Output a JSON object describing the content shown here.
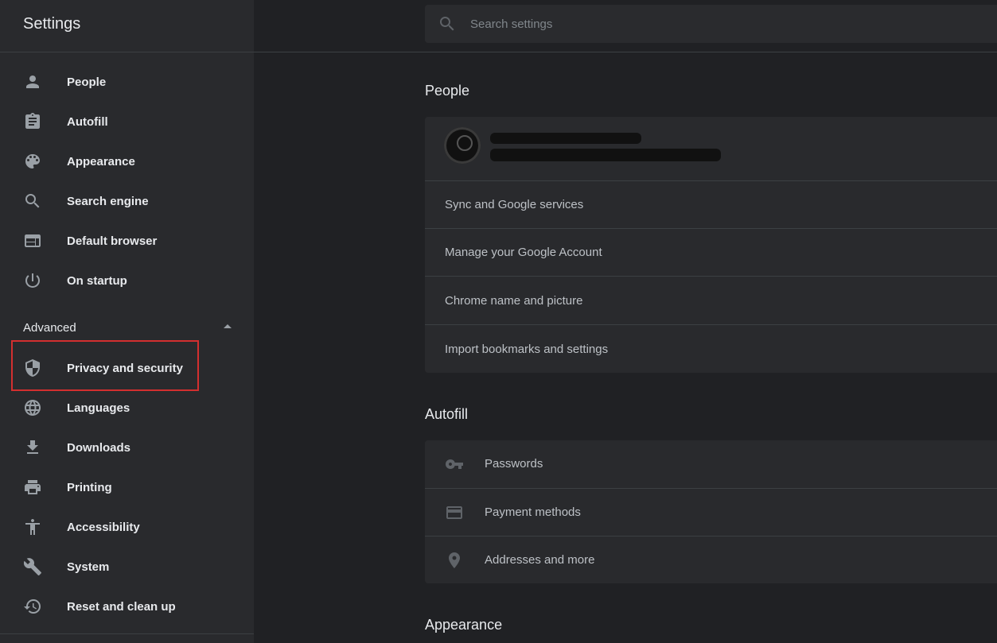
{
  "sidebar": {
    "title": "Settings",
    "items": [
      {
        "label": "People",
        "icon": "person-icon"
      },
      {
        "label": "Autofill",
        "icon": "clipboard-icon"
      },
      {
        "label": "Appearance",
        "icon": "palette-icon"
      },
      {
        "label": "Search engine",
        "icon": "search-icon"
      },
      {
        "label": "Default browser",
        "icon": "browser-window-icon"
      },
      {
        "label": "On startup",
        "icon": "power-icon"
      }
    ],
    "advanced_label": "Advanced",
    "advanced_items": [
      {
        "label": "Privacy and security",
        "icon": "shield-icon"
      },
      {
        "label": "Languages",
        "icon": "globe-icon"
      },
      {
        "label": "Downloads",
        "icon": "download-icon"
      },
      {
        "label": "Printing",
        "icon": "printer-icon"
      },
      {
        "label": "Accessibility",
        "icon": "accessibility-icon"
      },
      {
        "label": "System",
        "icon": "wrench-icon"
      },
      {
        "label": "Reset and clean up",
        "icon": "history-icon"
      }
    ]
  },
  "search": {
    "placeholder": "Search settings"
  },
  "main": {
    "people": {
      "title": "People",
      "rows": [
        {
          "label": "Sync and Google services"
        },
        {
          "label": "Manage your Google Account"
        },
        {
          "label": "Chrome name and picture"
        },
        {
          "label": "Import bookmarks and settings"
        }
      ]
    },
    "autofill": {
      "title": "Autofill",
      "rows": [
        {
          "label": "Passwords",
          "icon": "key-icon"
        },
        {
          "label": "Payment methods",
          "icon": "credit-card-icon"
        },
        {
          "label": "Addresses and more",
          "icon": "location-pin-icon"
        }
      ]
    },
    "appearance": {
      "title": "Appearance"
    }
  },
  "colors": {
    "sidebar_bg": "#292a2d",
    "page_bg": "#202124",
    "card_bg": "#292a2d",
    "highlight": "#d32f2f"
  }
}
